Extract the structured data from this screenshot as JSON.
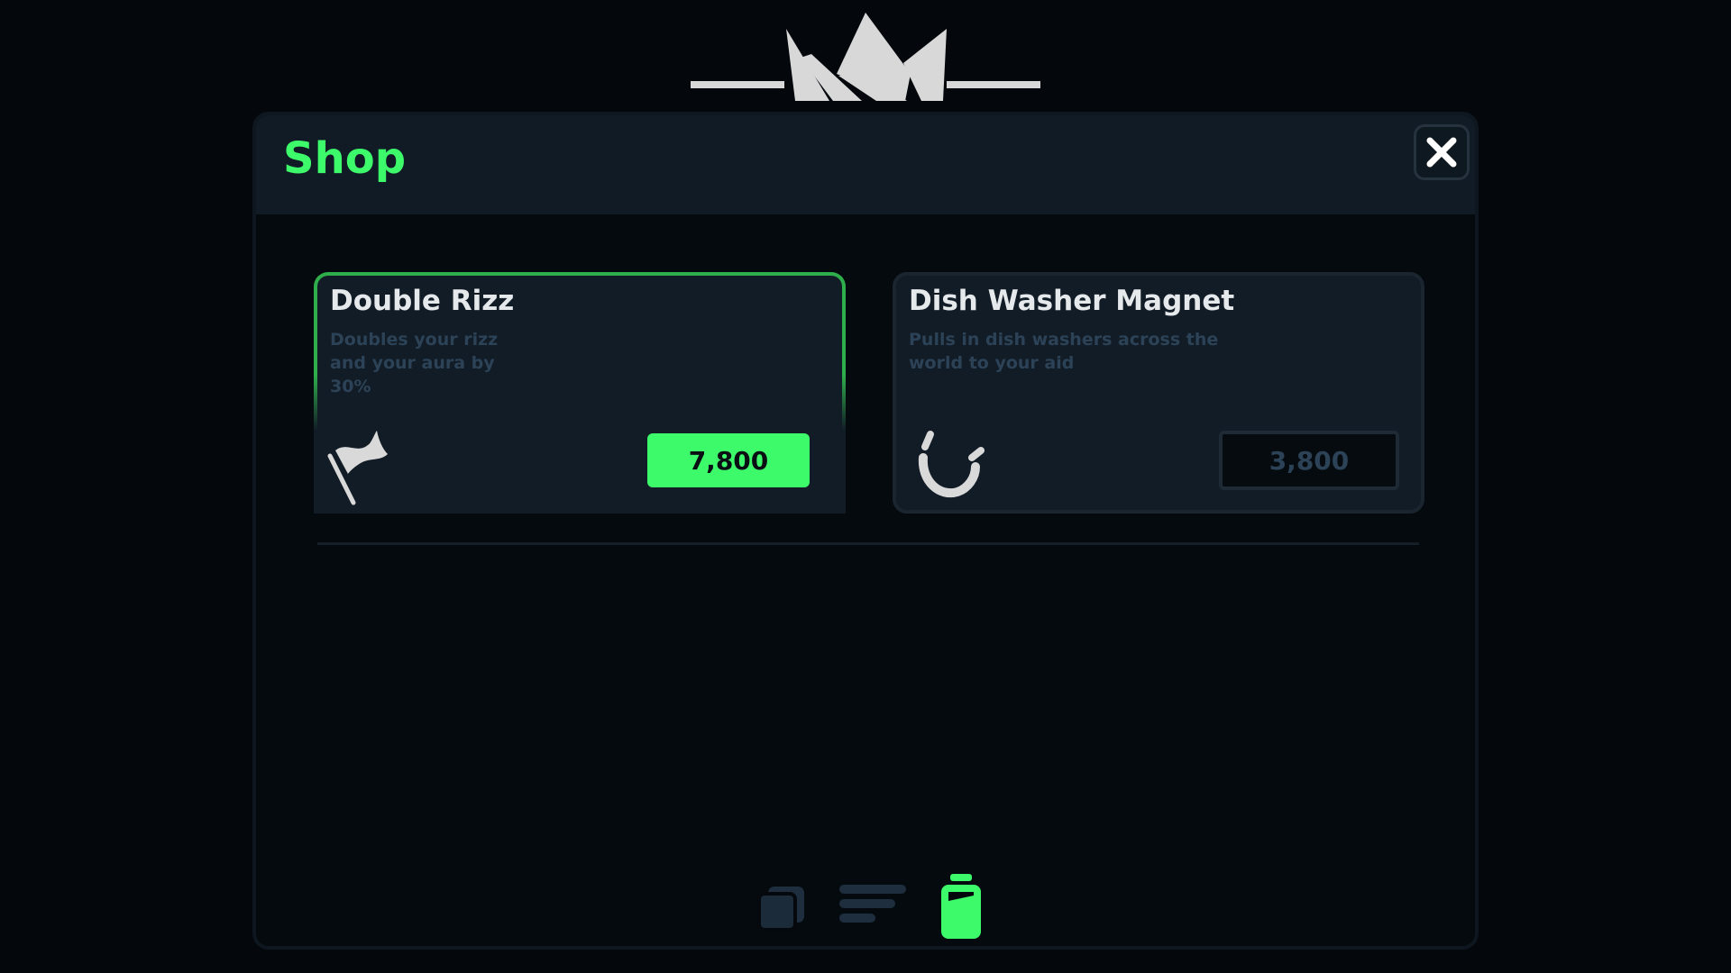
{
  "shop": {
    "title": "Shop",
    "items": [
      {
        "name": "Double Rizz",
        "description": "Doubles your rizz and your aura by 30%",
        "price": "7,800",
        "icon": "flag-icon",
        "state": "affordable"
      },
      {
        "name": "Dish Washer Magnet",
        "description": "Pulls in dish washers across the world to your aid",
        "price": "3,800",
        "icon": "magnet-icon",
        "state": "locked"
      }
    ]
  },
  "nav": {
    "tabs": [
      {
        "icon": "cards-icon",
        "active": false
      },
      {
        "icon": "list-icon",
        "active": false
      },
      {
        "icon": "jar-icon",
        "active": true
      }
    ]
  },
  "colors": {
    "accent": "#3dfa6b",
    "background": "#04080c",
    "panel": "#111b25",
    "muted_text": "#2c4257"
  }
}
